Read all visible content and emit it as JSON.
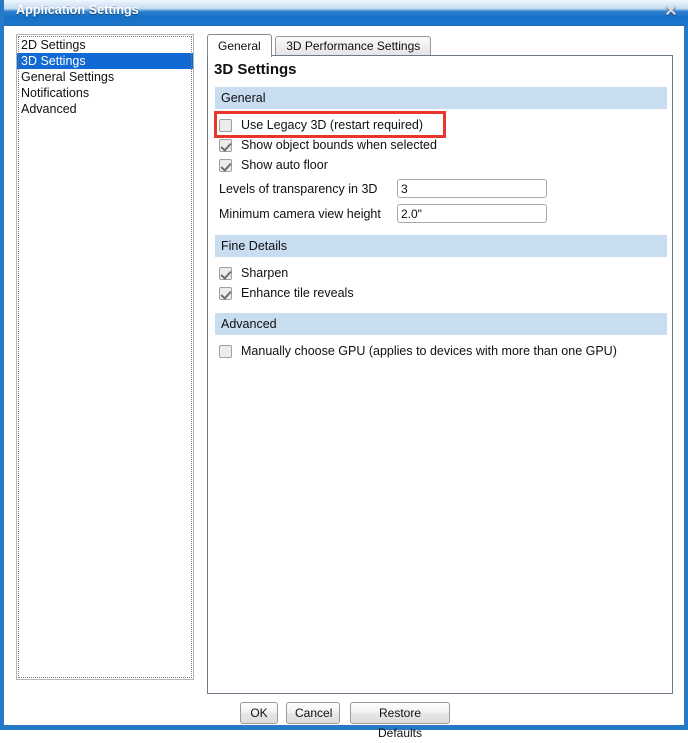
{
  "window": {
    "title": "Application Settings",
    "close_icon": "close-icon",
    "close_glyph": "✕",
    "title_bar_color": "#1570c8",
    "border_color": "#2878c8"
  },
  "sidebar": {
    "items": [
      {
        "label": "2D Settings",
        "selected": false
      },
      {
        "label": "3D Settings",
        "selected": true
      },
      {
        "label": "General Settings",
        "selected": false
      },
      {
        "label": "Notifications",
        "selected": false
      },
      {
        "label": "Advanced",
        "selected": false
      }
    ],
    "selection_color": "#1169d3"
  },
  "tabs": [
    {
      "label": "General",
      "active": true
    },
    {
      "label": "3D Performance Settings",
      "active": false
    }
  ],
  "panel": {
    "title": "3D Settings",
    "section_header_color": "#c9ddf1"
  },
  "sections": {
    "general": {
      "header": "General",
      "checkboxes": [
        {
          "label": "Use Legacy 3D (restart required)",
          "checked": false,
          "highlighted": true
        },
        {
          "label": "Show object bounds when selected",
          "checked": true,
          "highlighted": false
        },
        {
          "label": "Show auto floor",
          "checked": true,
          "highlighted": false
        }
      ],
      "fields": [
        {
          "label": "Levels of transparency in 3D",
          "value": "3",
          "placeholder": ""
        },
        {
          "label": "Minimum camera view height",
          "value": "2.0\"",
          "placeholder": ""
        }
      ]
    },
    "fine_details": {
      "header": "Fine Details",
      "checkboxes": [
        {
          "label": "Sharpen",
          "checked": true,
          "highlighted": false
        },
        {
          "label": "Enhance tile reveals",
          "checked": true,
          "highlighted": false
        }
      ]
    },
    "advanced": {
      "header": "Advanced",
      "checkboxes": [
        {
          "label": "Manually choose GPU (applies to devices with more than one GPU)",
          "checked": false,
          "highlighted": false
        }
      ]
    }
  },
  "highlight": {
    "color": "#e8352e",
    "target": "Use Legacy 3D (restart required)"
  },
  "footer": {
    "ok_label": "OK",
    "cancel_label": "Cancel",
    "restore_label": "Restore Defaults"
  }
}
